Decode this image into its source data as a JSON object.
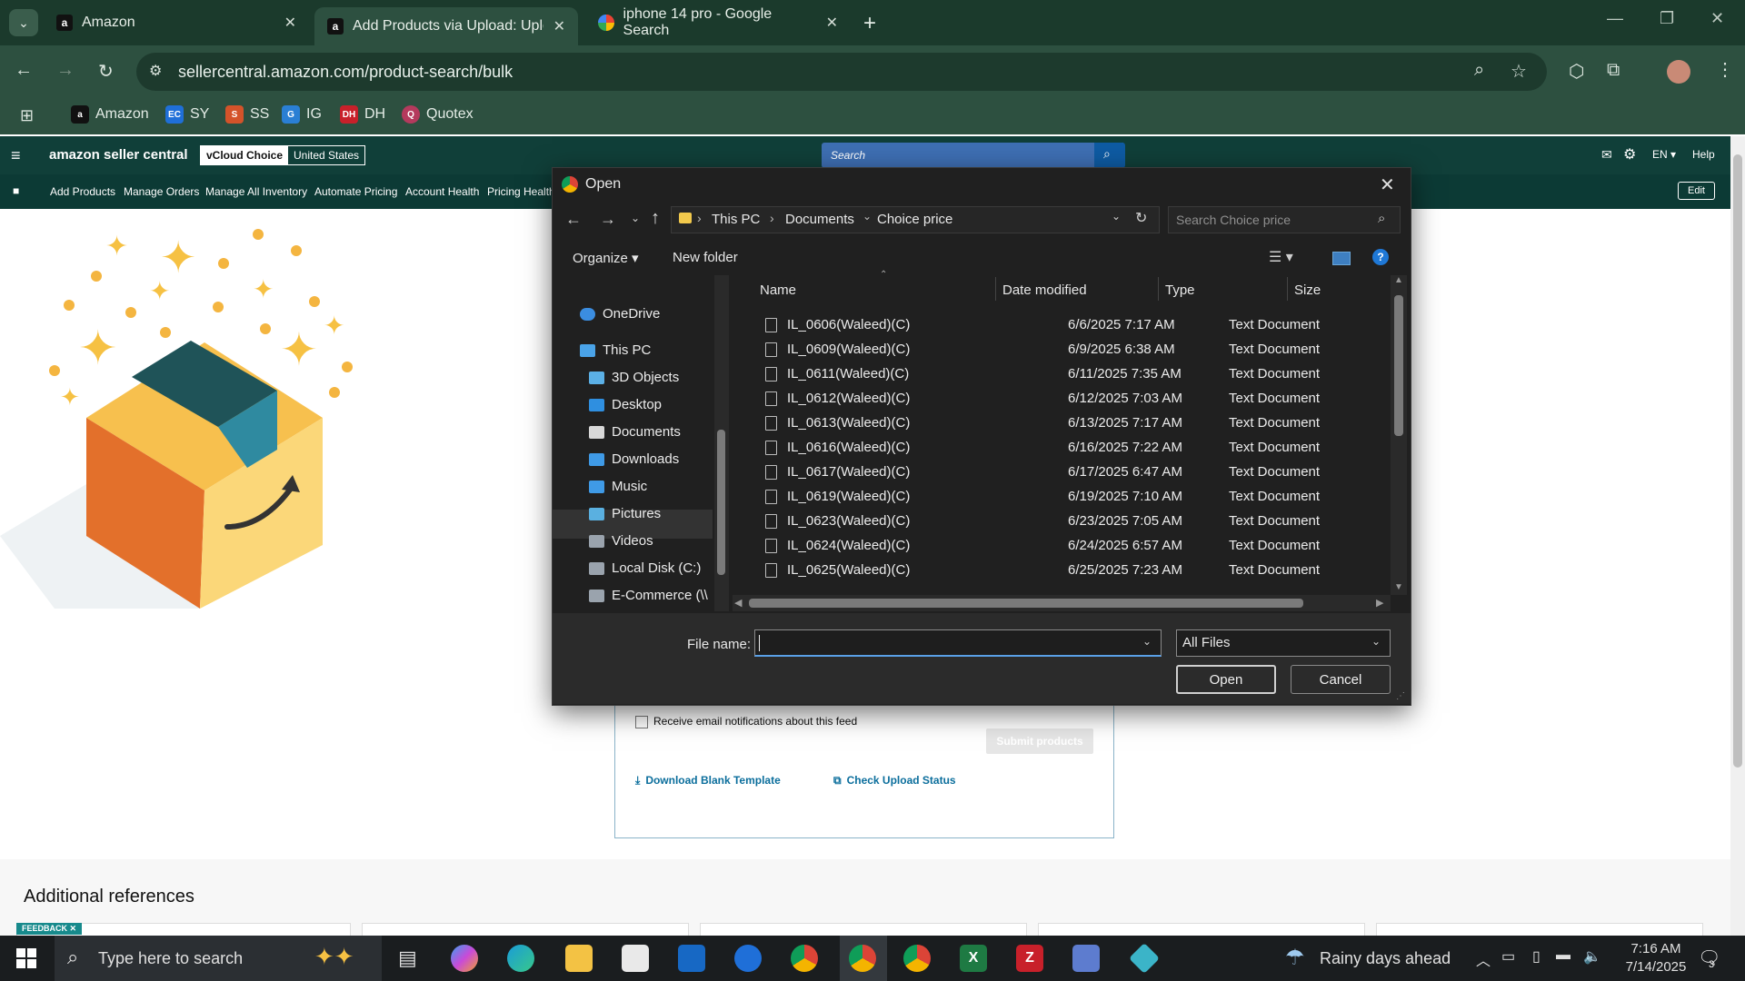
{
  "tabs": [
    {
      "label": "Amazon"
    },
    {
      "label": "Add Products via Upload: Uploa"
    },
    {
      "label": "iphone 14 pro - Google Search"
    }
  ],
  "address": {
    "url": "sellercentral.amazon.com/product-search/bulk"
  },
  "bookmarks": [
    {
      "label": "Amazon"
    },
    {
      "label": "SY"
    },
    {
      "label": "SS"
    },
    {
      "label": "IG"
    },
    {
      "label": "DH"
    },
    {
      "label": "Quotex"
    }
  ],
  "amazon": {
    "logo": "amazon seller central",
    "store_name": "vCloud Choice",
    "store_region": "United States",
    "search_placeholder": "Search",
    "lang": "EN",
    "help": "Help",
    "edit": "Edit",
    "nav": [
      "Add Products",
      "Manage Orders",
      "Manage All Inventory",
      "Automate Pricing",
      "Account Health",
      "Pricing Health"
    ]
  },
  "page": {
    "email_notify": "Receive email notifications about this feed",
    "submit": "Submit products",
    "download_template": "Download Blank Template",
    "check_status": "Check Upload Status",
    "additional_refs": "Additional references",
    "feedback": "FEEDBACK"
  },
  "dialog": {
    "title": "Open",
    "breadcrumb": [
      "This PC",
      "Documents",
      "Choice price"
    ],
    "search_placeholder": "Search Choice price",
    "organize": "Organize",
    "new_folder": "New folder",
    "columns": {
      "name": "Name",
      "date": "Date modified",
      "type": "Type",
      "size": "Size"
    },
    "tree": [
      {
        "label": "OneDrive",
        "color": "#3b8de0"
      },
      {
        "label": "This PC",
        "color": "#4aa3e8"
      },
      {
        "label": "3D Objects",
        "color": "#5bb0e6"
      },
      {
        "label": "Desktop",
        "color": "#2f8fe0"
      },
      {
        "label": "Documents",
        "color": "#d8d8d8"
      },
      {
        "label": "Downloads",
        "color": "#3f9ae6"
      },
      {
        "label": "Music",
        "color": "#3f9ae6"
      },
      {
        "label": "Pictures",
        "color": "#5ab0e0"
      },
      {
        "label": "Videos",
        "color": "#9aa3ad"
      },
      {
        "label": "Local Disk (C:)",
        "color": "#9aa3ad"
      },
      {
        "label": "E-Commerce (\\\\",
        "color": "#9aa3ad"
      }
    ],
    "files": [
      {
        "name": "IL_0606(Waleed)(C)",
        "date": "6/6/2025 7:17 AM",
        "type": "Text Document"
      },
      {
        "name": "IL_0609(Waleed)(C)",
        "date": "6/9/2025 6:38 AM",
        "type": "Text Document"
      },
      {
        "name": "IL_0611(Waleed)(C)",
        "date": "6/11/2025 7:35 AM",
        "type": "Text Document"
      },
      {
        "name": "IL_0612(Waleed)(C)",
        "date": "6/12/2025 7:03 AM",
        "type": "Text Document"
      },
      {
        "name": "IL_0613(Waleed)(C)",
        "date": "6/13/2025 7:17 AM",
        "type": "Text Document"
      },
      {
        "name": "IL_0616(Waleed)(C)",
        "date": "6/16/2025 7:22 AM",
        "type": "Text Document"
      },
      {
        "name": "IL_0617(Waleed)(C)",
        "date": "6/17/2025 6:47 AM",
        "type": "Text Document"
      },
      {
        "name": "IL_0619(Waleed)(C)",
        "date": "6/19/2025 7:10 AM",
        "type": "Text Document"
      },
      {
        "name": "IL_0623(Waleed)(C)",
        "date": "6/23/2025 7:05 AM",
        "type": "Text Document"
      },
      {
        "name": "IL_0624(Waleed)(C)",
        "date": "6/24/2025 6:57 AM",
        "type": "Text Document"
      },
      {
        "name": "IL_0625(Waleed)(C)",
        "date": "6/25/2025 7:23 AM",
        "type": "Text Document"
      }
    ],
    "filename_label": "File name:",
    "filename_value": "",
    "filter": "All Files",
    "open": "Open",
    "cancel": "Cancel"
  },
  "taskbar": {
    "search_placeholder": "Type here to search",
    "weather": "Rainy days ahead",
    "time": "7:16 AM",
    "date": "7/14/2025",
    "notifications": "3"
  }
}
